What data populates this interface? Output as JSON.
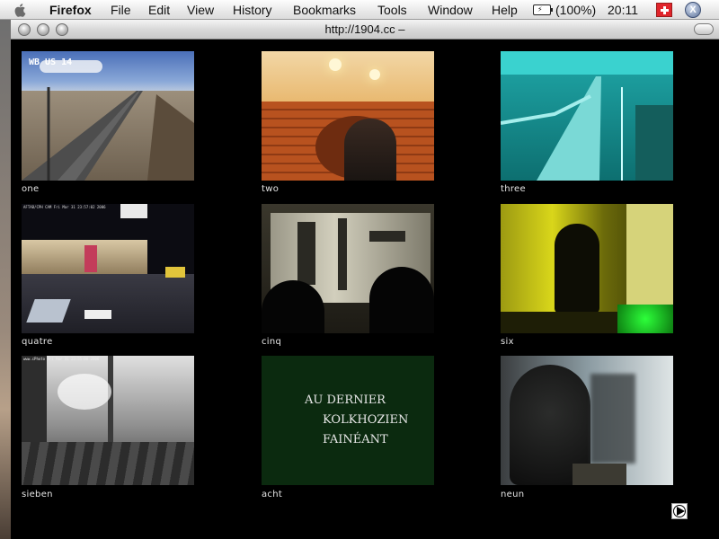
{
  "menubar": {
    "apple_icon": "apple-icon",
    "app_name": "Firefox",
    "menus": [
      "File",
      "Edit",
      "View",
      "History",
      "Bookmarks",
      "Tools",
      "Window",
      "Help"
    ],
    "battery_icon": "battery-plug-icon",
    "battery_text": "(100%)",
    "clock": "20:11",
    "flag_icon": "swiss-flag-icon",
    "close_icon": "x-icon"
  },
  "window": {
    "title": "http://1904.cc –",
    "buttons": [
      "close",
      "minimize",
      "zoom"
    ]
  },
  "cameras": [
    {
      "label": "one",
      "overlay": "WB US 14"
    },
    {
      "label": "two",
      "overlay": ""
    },
    {
      "label": "three",
      "overlay": ""
    },
    {
      "label": "quatre",
      "overlay": "AFTAB/CPH CAM   Fri Mar 31  23:57:02  2006"
    },
    {
      "label": "cinq",
      "overlay": ""
    },
    {
      "label": "six",
      "overlay": ""
    },
    {
      "label": "sieben",
      "overlay": "www.cPhoto  Fri Mar 31  23:55:08  2006"
    },
    {
      "label": "acht",
      "overlay": "",
      "lines": [
        "AU DERNIER",
        "KOLKHOZIEN",
        "FAINÉANT"
      ]
    },
    {
      "label": "neun",
      "overlay": ""
    }
  ],
  "next_icon": "play-next-icon",
  "colors": {
    "page_background": "#000000",
    "label_text": "#e6e6e6",
    "menubar_background": "#eeeeee"
  }
}
